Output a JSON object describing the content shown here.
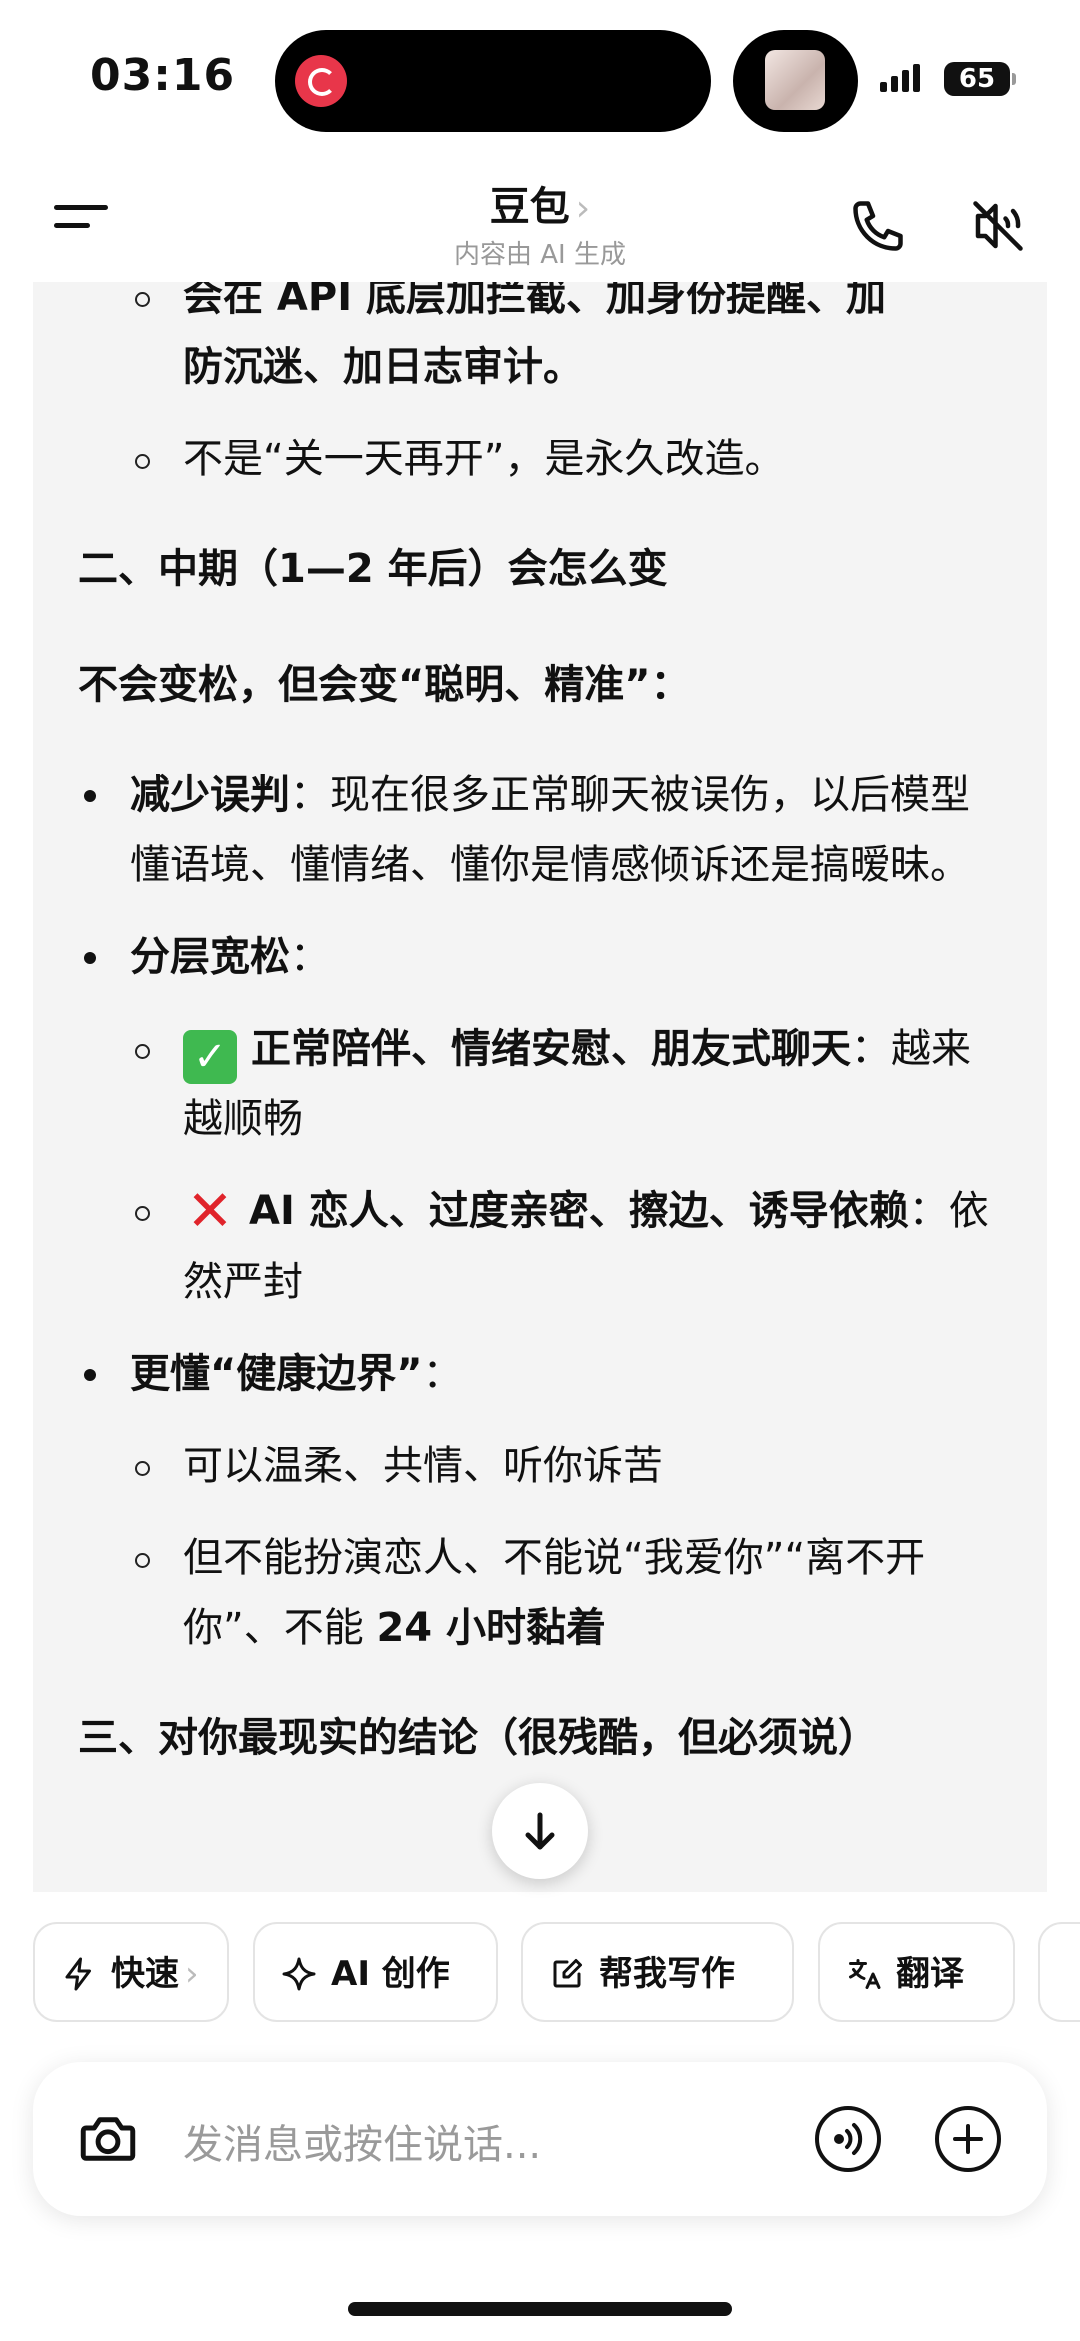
{
  "status_bar": {
    "time": "03:16",
    "battery": "65"
  },
  "header": {
    "title": "豆包",
    "title_chevron": "›",
    "subtitle": "内容由 AI 生成"
  },
  "chat": {
    "lines": {
      "l1": "会在 API 底层加拦截、加身份提醒、加",
      "l2": "防沉迷、加日志审计。",
      "l3": "不是“关一天再开”，是永久改造。",
      "h2": "二、中期（1—2 年后）会怎么变",
      "p1": "不会变松，但会变“聪明、精准”：",
      "b1_bold": "减少误判",
      "b1_text": "：现在很多正常聊天被误伤，以后模型懂语境、懂情绪、懂你是情感倾诉还是搞暧昧。",
      "b2_bold": "分层宽松",
      "b2_colon": "：",
      "s1_bold": "正常陪伴、情绪安慰、朋友式聊天",
      "s1_text": "：越来越顺畅",
      "s2_bold": "AI 恋人、过度亲密、擦边、诱导依赖",
      "s2_text": "：依然严封",
      "b3_bold": "更懂“健康边界”",
      "b3_colon": "：",
      "s3": "可以温柔、共情、听你诉苦",
      "s4_a": "但不能扮演恋人、不能说“我爱你”“离不开你”、不能 ",
      "s4_b": "24 小时黏着",
      "h3": "三、对你最现实的结论（很残酷，但必须说）"
    },
    "emoji": {
      "check": "✓",
      "cross": "✕"
    }
  },
  "chips": {
    "fast": "快速",
    "fast_chevron": "›",
    "ai_create": "AI 创作",
    "write": "帮我写作",
    "translate": "翻译"
  },
  "input": {
    "placeholder": "发消息或按住说话..."
  }
}
